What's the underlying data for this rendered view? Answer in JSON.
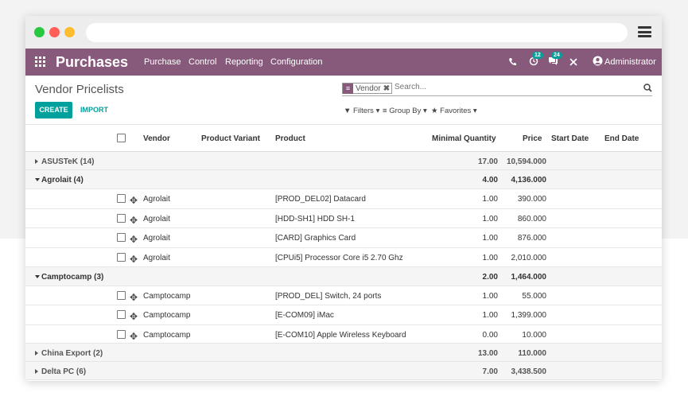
{
  "colors": {
    "brand": "#875a7b",
    "accent": "#00a09d",
    "dot_green": "#28c840",
    "dot_red": "#ff5f57",
    "dot_yellow": "#febc2e"
  },
  "app": {
    "name": "Purchases"
  },
  "menu": [
    "Purchase",
    "Control",
    "Reporting",
    "Configuration"
  ],
  "navbar": {
    "user": "Administrator",
    "activity_count": "12",
    "messages_count": "24"
  },
  "page": {
    "title": "Vendor Pricelists"
  },
  "search": {
    "facet": "Vendor",
    "placeholder": "Search..."
  },
  "buttons": {
    "create": "CREATE",
    "import": "IMPORT"
  },
  "filters": {
    "filters": "Filters",
    "group_by": "Group By",
    "favorites": "Favorites"
  },
  "columns": {
    "vendor": "Vendor",
    "variant": "Product Variant",
    "product": "Product",
    "min_qty": "Minimal Quantity",
    "price": "Price",
    "start": "Start Date",
    "end": "End Date"
  },
  "rows": [
    {
      "type": "group",
      "open": false,
      "label": "ASUSTeK (14)",
      "qty": "17.00",
      "price": "10,594.000"
    },
    {
      "type": "group",
      "open": true,
      "label": "Agrolait (4)",
      "qty": "4.00",
      "price": "4,136.000"
    },
    {
      "type": "record",
      "vendor": "Agrolait",
      "product": "[PROD_DEL02] Datacard",
      "qty": "1.00",
      "price": "390.000"
    },
    {
      "type": "record",
      "vendor": "Agrolait",
      "product": "[HDD-SH1] HDD SH-1",
      "qty": "1.00",
      "price": "860.000"
    },
    {
      "type": "record",
      "vendor": "Agrolait",
      "product": "[CARD] Graphics Card",
      "qty": "1.00",
      "price": "876.000"
    },
    {
      "type": "record",
      "vendor": "Agrolait",
      "product": "[CPUi5] Processor Core i5 2.70 Ghz",
      "qty": "1.00",
      "price": "2,010.000"
    },
    {
      "type": "group",
      "open": true,
      "label": "Camptocamp (3)",
      "qty": "2.00",
      "price": "1,464.000"
    },
    {
      "type": "record",
      "vendor": "Camptocamp",
      "product": "[PROD_DEL] Switch, 24 ports",
      "qty": "1.00",
      "price": "55.000"
    },
    {
      "type": "record",
      "vendor": "Camptocamp",
      "product": "[E-COM09] iMac",
      "qty": "1.00",
      "price": "1,399.000"
    },
    {
      "type": "record",
      "vendor": "Camptocamp",
      "product": "[E-COM10] Apple Wireless Keyboard",
      "qty": "0.00",
      "price": "10.000"
    },
    {
      "type": "group",
      "open": false,
      "label": "China Export (2)",
      "qty": "13.00",
      "price": "110.000"
    },
    {
      "type": "group",
      "open": false,
      "label": "Delta PC (6)",
      "qty": "7.00",
      "price": "3,438.500"
    }
  ]
}
